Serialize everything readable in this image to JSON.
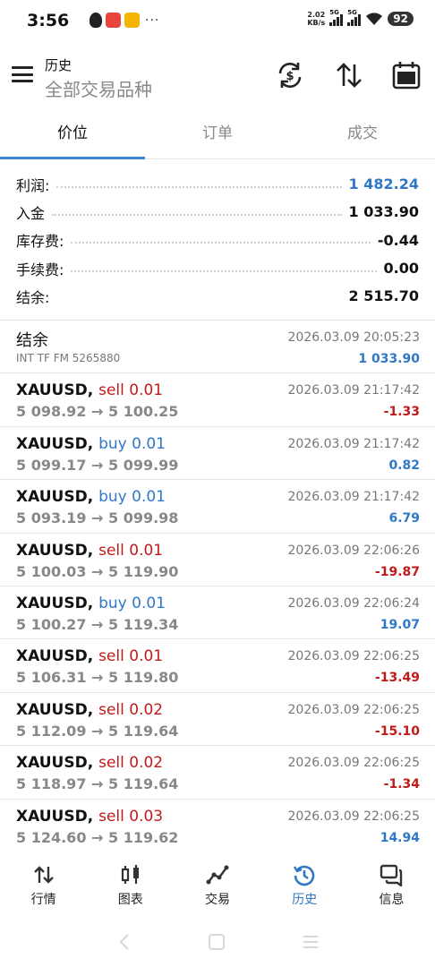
{
  "status_bar": {
    "time": "3:56",
    "dots": "···",
    "net_speed_value": "2.02",
    "net_speed_unit": "KB/s",
    "sim1": "5G",
    "sim2": "5G",
    "battery": "92"
  },
  "header": {
    "title": "历史",
    "subtitle": "全部交易品种"
  },
  "tabs": [
    {
      "label": "价位",
      "active": true
    },
    {
      "label": "订单",
      "active": false
    },
    {
      "label": "成交",
      "active": false
    }
  ],
  "summary": [
    {
      "label": "利润:",
      "value": "1 482.24",
      "color": "#2f78c8"
    },
    {
      "label": "入金",
      "value": "1 033.90",
      "color": "#111111"
    },
    {
      "label": "库存费:",
      "value": "-0.44",
      "color": "#111111"
    },
    {
      "label": "手续费:",
      "value": "0.00",
      "color": "#111111"
    },
    {
      "label": "结余:",
      "value": "2 515.70",
      "color": "#111111"
    }
  ],
  "balance_entry": {
    "title": "结余",
    "description": "INT TF FM 5265880",
    "time": "2026.03.09 20:05:23",
    "amount": "1 033.90"
  },
  "deals": [
    {
      "symbol": "XAUUSD,",
      "side": "sell 0.01",
      "direction": "sell",
      "prices": "5 098.92 → 5 100.25",
      "time": "2026.03.09 21:17:42",
      "profit": "-1.33"
    },
    {
      "symbol": "XAUUSD,",
      "side": "buy 0.01",
      "direction": "buy",
      "prices": "5 099.17 → 5 099.99",
      "time": "2026.03.09 21:17:42",
      "profit": "0.82"
    },
    {
      "symbol": "XAUUSD,",
      "side": "buy 0.01",
      "direction": "buy",
      "prices": "5 093.19 → 5 099.98",
      "time": "2026.03.09 21:17:42",
      "profit": "6.79"
    },
    {
      "symbol": "XAUUSD,",
      "side": "sell 0.01",
      "direction": "sell",
      "prices": "5 100.03 → 5 119.90",
      "time": "2026.03.09 22:06:26",
      "profit": "-19.87"
    },
    {
      "symbol": "XAUUSD,",
      "side": "buy 0.01",
      "direction": "buy",
      "prices": "5 100.27 → 5 119.34",
      "time": "2026.03.09 22:06:24",
      "profit": "19.07"
    },
    {
      "symbol": "XAUUSD,",
      "side": "sell 0.01",
      "direction": "sell",
      "prices": "5 106.31 → 5 119.80",
      "time": "2026.03.09 22:06:25",
      "profit": "-13.49"
    },
    {
      "symbol": "XAUUSD,",
      "side": "sell 0.02",
      "direction": "sell",
      "prices": "5 112.09 → 5 119.64",
      "time": "2026.03.09 22:06:25",
      "profit": "-15.10"
    },
    {
      "symbol": "XAUUSD,",
      "side": "sell 0.02",
      "direction": "sell",
      "prices": "5 118.97 → 5 119.64",
      "time": "2026.03.09 22:06:25",
      "profit": "-1.34"
    },
    {
      "symbol": "XAUUSD,",
      "side": "sell 0.03",
      "direction": "sell",
      "prices": "5 124.60 → 5 119.62",
      "time": "2026.03.09 22:06:25",
      "profit": "14.94"
    }
  ],
  "bottom_nav": [
    {
      "label": "行情",
      "icon": "quotes-icon",
      "active": false
    },
    {
      "label": "图表",
      "icon": "chart-icon",
      "active": false
    },
    {
      "label": "交易",
      "icon": "trade-icon",
      "active": false
    },
    {
      "label": "历史",
      "icon": "history-icon",
      "active": true
    },
    {
      "label": "信息",
      "icon": "messages-icon",
      "active": false
    }
  ],
  "colors": {
    "accent": "#2f78c8",
    "loss": "#c01a1a",
    "tab_indicator": "#3a87d6"
  }
}
